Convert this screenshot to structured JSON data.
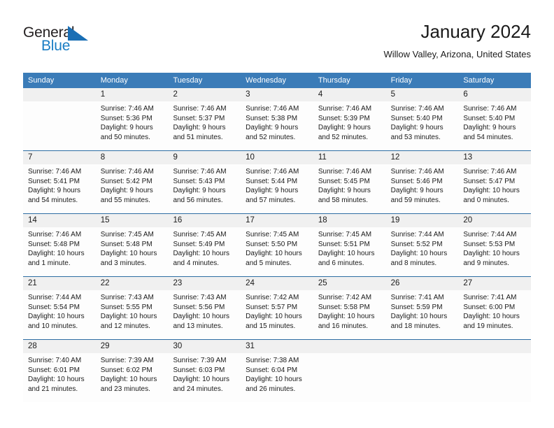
{
  "brand": {
    "name_part1": "General",
    "name_part2": "Blue",
    "triangle_color": "#1a6fb5",
    "blue_color": "#1a7dc4"
  },
  "header": {
    "title": "January 2024",
    "location": "Willow Valley, Arizona, United States"
  },
  "theme": {
    "header_blue": "#3b7cb8",
    "row_divider_blue": "#2d6da3",
    "daynum_band_gray": "#f0f0f0",
    "text_color": "#1a1a1a"
  },
  "calendar": {
    "weekdays": [
      "Sunday",
      "Monday",
      "Tuesday",
      "Wednesday",
      "Thursday",
      "Friday",
      "Saturday"
    ],
    "weeks": [
      [
        {
          "day": "",
          "empty": true
        },
        {
          "day": "1",
          "sunrise": "Sunrise: 7:46 AM",
          "sunset": "Sunset: 5:36 PM",
          "daylight1": "Daylight: 9 hours",
          "daylight2": "and 50 minutes."
        },
        {
          "day": "2",
          "sunrise": "Sunrise: 7:46 AM",
          "sunset": "Sunset: 5:37 PM",
          "daylight1": "Daylight: 9 hours",
          "daylight2": "and 51 minutes."
        },
        {
          "day": "3",
          "sunrise": "Sunrise: 7:46 AM",
          "sunset": "Sunset: 5:38 PM",
          "daylight1": "Daylight: 9 hours",
          "daylight2": "and 52 minutes."
        },
        {
          "day": "4",
          "sunrise": "Sunrise: 7:46 AM",
          "sunset": "Sunset: 5:39 PM",
          "daylight1": "Daylight: 9 hours",
          "daylight2": "and 52 minutes."
        },
        {
          "day": "5",
          "sunrise": "Sunrise: 7:46 AM",
          "sunset": "Sunset: 5:40 PM",
          "daylight1": "Daylight: 9 hours",
          "daylight2": "and 53 minutes."
        },
        {
          "day": "6",
          "sunrise": "Sunrise: 7:46 AM",
          "sunset": "Sunset: 5:40 PM",
          "daylight1": "Daylight: 9 hours",
          "daylight2": "and 54 minutes."
        }
      ],
      [
        {
          "day": "7",
          "sunrise": "Sunrise: 7:46 AM",
          "sunset": "Sunset: 5:41 PM",
          "daylight1": "Daylight: 9 hours",
          "daylight2": "and 54 minutes."
        },
        {
          "day": "8",
          "sunrise": "Sunrise: 7:46 AM",
          "sunset": "Sunset: 5:42 PM",
          "daylight1": "Daylight: 9 hours",
          "daylight2": "and 55 minutes."
        },
        {
          "day": "9",
          "sunrise": "Sunrise: 7:46 AM",
          "sunset": "Sunset: 5:43 PM",
          "daylight1": "Daylight: 9 hours",
          "daylight2": "and 56 minutes."
        },
        {
          "day": "10",
          "sunrise": "Sunrise: 7:46 AM",
          "sunset": "Sunset: 5:44 PM",
          "daylight1": "Daylight: 9 hours",
          "daylight2": "and 57 minutes."
        },
        {
          "day": "11",
          "sunrise": "Sunrise: 7:46 AM",
          "sunset": "Sunset: 5:45 PM",
          "daylight1": "Daylight: 9 hours",
          "daylight2": "and 58 minutes."
        },
        {
          "day": "12",
          "sunrise": "Sunrise: 7:46 AM",
          "sunset": "Sunset: 5:46 PM",
          "daylight1": "Daylight: 9 hours",
          "daylight2": "and 59 minutes."
        },
        {
          "day": "13",
          "sunrise": "Sunrise: 7:46 AM",
          "sunset": "Sunset: 5:47 PM",
          "daylight1": "Daylight: 10 hours",
          "daylight2": "and 0 minutes."
        }
      ],
      [
        {
          "day": "14",
          "sunrise": "Sunrise: 7:46 AM",
          "sunset": "Sunset: 5:48 PM",
          "daylight1": "Daylight: 10 hours",
          "daylight2": "and 1 minute."
        },
        {
          "day": "15",
          "sunrise": "Sunrise: 7:45 AM",
          "sunset": "Sunset: 5:48 PM",
          "daylight1": "Daylight: 10 hours",
          "daylight2": "and 3 minutes."
        },
        {
          "day": "16",
          "sunrise": "Sunrise: 7:45 AM",
          "sunset": "Sunset: 5:49 PM",
          "daylight1": "Daylight: 10 hours",
          "daylight2": "and 4 minutes."
        },
        {
          "day": "17",
          "sunrise": "Sunrise: 7:45 AM",
          "sunset": "Sunset: 5:50 PM",
          "daylight1": "Daylight: 10 hours",
          "daylight2": "and 5 minutes."
        },
        {
          "day": "18",
          "sunrise": "Sunrise: 7:45 AM",
          "sunset": "Sunset: 5:51 PM",
          "daylight1": "Daylight: 10 hours",
          "daylight2": "and 6 minutes."
        },
        {
          "day": "19",
          "sunrise": "Sunrise: 7:44 AM",
          "sunset": "Sunset: 5:52 PM",
          "daylight1": "Daylight: 10 hours",
          "daylight2": "and 8 minutes."
        },
        {
          "day": "20",
          "sunrise": "Sunrise: 7:44 AM",
          "sunset": "Sunset: 5:53 PM",
          "daylight1": "Daylight: 10 hours",
          "daylight2": "and 9 minutes."
        }
      ],
      [
        {
          "day": "21",
          "sunrise": "Sunrise: 7:44 AM",
          "sunset": "Sunset: 5:54 PM",
          "daylight1": "Daylight: 10 hours",
          "daylight2": "and 10 minutes."
        },
        {
          "day": "22",
          "sunrise": "Sunrise: 7:43 AM",
          "sunset": "Sunset: 5:55 PM",
          "daylight1": "Daylight: 10 hours",
          "daylight2": "and 12 minutes."
        },
        {
          "day": "23",
          "sunrise": "Sunrise: 7:43 AM",
          "sunset": "Sunset: 5:56 PM",
          "daylight1": "Daylight: 10 hours",
          "daylight2": "and 13 minutes."
        },
        {
          "day": "24",
          "sunrise": "Sunrise: 7:42 AM",
          "sunset": "Sunset: 5:57 PM",
          "daylight1": "Daylight: 10 hours",
          "daylight2": "and 15 minutes."
        },
        {
          "day": "25",
          "sunrise": "Sunrise: 7:42 AM",
          "sunset": "Sunset: 5:58 PM",
          "daylight1": "Daylight: 10 hours",
          "daylight2": "and 16 minutes."
        },
        {
          "day": "26",
          "sunrise": "Sunrise: 7:41 AM",
          "sunset": "Sunset: 5:59 PM",
          "daylight1": "Daylight: 10 hours",
          "daylight2": "and 18 minutes."
        },
        {
          "day": "27",
          "sunrise": "Sunrise: 7:41 AM",
          "sunset": "Sunset: 6:00 PM",
          "daylight1": "Daylight: 10 hours",
          "daylight2": "and 19 minutes."
        }
      ],
      [
        {
          "day": "28",
          "sunrise": "Sunrise: 7:40 AM",
          "sunset": "Sunset: 6:01 PM",
          "daylight1": "Daylight: 10 hours",
          "daylight2": "and 21 minutes."
        },
        {
          "day": "29",
          "sunrise": "Sunrise: 7:39 AM",
          "sunset": "Sunset: 6:02 PM",
          "daylight1": "Daylight: 10 hours",
          "daylight2": "and 23 minutes."
        },
        {
          "day": "30",
          "sunrise": "Sunrise: 7:39 AM",
          "sunset": "Sunset: 6:03 PM",
          "daylight1": "Daylight: 10 hours",
          "daylight2": "and 24 minutes."
        },
        {
          "day": "31",
          "sunrise": "Sunrise: 7:38 AM",
          "sunset": "Sunset: 6:04 PM",
          "daylight1": "Daylight: 10 hours",
          "daylight2": "and 26 minutes."
        },
        {
          "day": "",
          "empty": true
        },
        {
          "day": "",
          "empty": true
        },
        {
          "day": "",
          "empty": true
        }
      ]
    ]
  }
}
